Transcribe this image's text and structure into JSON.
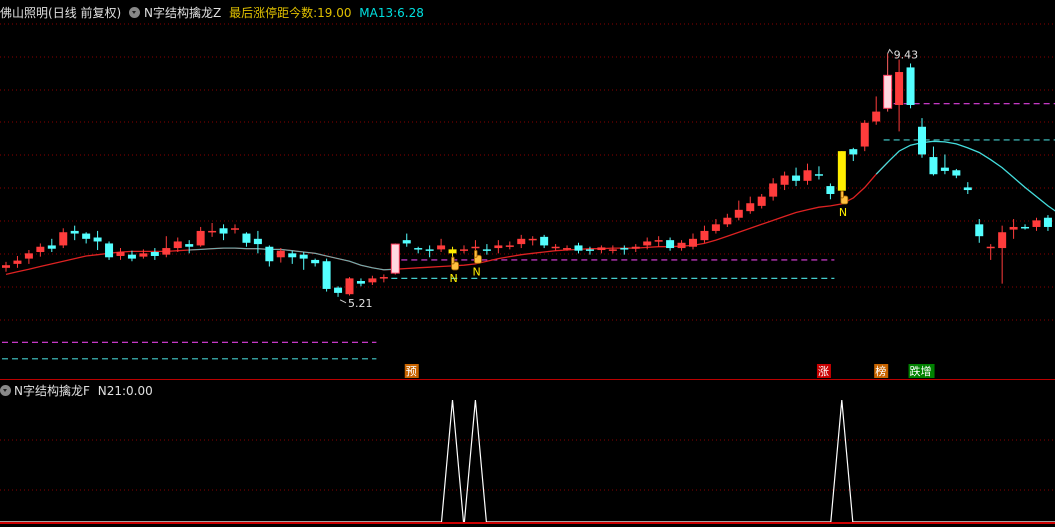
{
  "header": {
    "stock_name": "佛山照明",
    "period": "(日线 前复权)",
    "indicator_name": "N字结构擒龙Z",
    "last_limit_label": "最后涨停距今数:",
    "last_limit_value": "19.00",
    "ma_label": "MA13:",
    "ma_value": "6.28",
    "colors": {
      "stock": "#e0e0e0",
      "indicator": "#e0e0e0",
      "label": "#ffff00",
      "ma": "#00ffff"
    }
  },
  "sub_header": {
    "indicator_name": "N字结构擒龙F",
    "n21_label": "N21:",
    "n21_value": "0.00"
  },
  "annotations": {
    "high_label": "9.43",
    "low_label": "5.21",
    "n_marker": "N",
    "signals": [
      {
        "text": "预",
        "color": "#c86400"
      },
      {
        "text": "涨",
        "color": "#c80000"
      },
      {
        "text": "榜",
        "color": "#c86400"
      },
      {
        "text": "跌增",
        "color": "#008000"
      }
    ]
  },
  "chart_data": [
    {
      "type": "candlestick",
      "title": "佛山照明",
      "ylim": [
        4.6,
        10.0
      ],
      "up_color": "#ff3c3c",
      "down_color": "#54ffff",
      "ma_color": "#dd2222",
      "ma_color_after_peak": "#44dddd",
      "candles": [
        {
          "o": 6.18,
          "h": 6.27,
          "c": 6.22,
          "l": 6.12
        },
        {
          "o": 6.24,
          "h": 6.36,
          "c": 6.29,
          "l": 6.18
        },
        {
          "o": 6.32,
          "h": 6.45,
          "c": 6.4,
          "l": 6.24
        },
        {
          "o": 6.42,
          "h": 6.55,
          "c": 6.5,
          "l": 6.35
        },
        {
          "o": 6.52,
          "h": 6.62,
          "c": 6.47,
          "l": 6.42
        },
        {
          "o": 6.52,
          "h": 6.78,
          "c": 6.72,
          "l": 6.48
        },
        {
          "o": 6.74,
          "h": 6.82,
          "c": 6.7,
          "l": 6.6
        },
        {
          "o": 6.7,
          "h": 6.72,
          "c": 6.62,
          "l": 6.55
        },
        {
          "o": 6.64,
          "h": 6.74,
          "c": 6.58,
          "l": 6.45
        },
        {
          "o": 6.55,
          "h": 6.58,
          "c": 6.34,
          "l": 6.3
        },
        {
          "o": 6.36,
          "h": 6.48,
          "c": 6.42,
          "l": 6.3
        },
        {
          "o": 6.38,
          "h": 6.44,
          "c": 6.32,
          "l": 6.28
        },
        {
          "o": 6.35,
          "h": 6.46,
          "c": 6.4,
          "l": 6.32
        },
        {
          "o": 6.42,
          "h": 6.48,
          "c": 6.36,
          "l": 6.3
        },
        {
          "o": 6.38,
          "h": 6.66,
          "c": 6.48,
          "l": 6.34
        },
        {
          "o": 6.48,
          "h": 6.64,
          "c": 6.58,
          "l": 6.42
        },
        {
          "o": 6.54,
          "h": 6.6,
          "c": 6.5,
          "l": 6.4
        },
        {
          "o": 6.52,
          "h": 6.8,
          "c": 6.74,
          "l": 6.5
        },
        {
          "o": 6.72,
          "h": 6.86,
          "c": 6.74,
          "l": 6.65
        },
        {
          "o": 6.78,
          "h": 6.84,
          "c": 6.7,
          "l": 6.6
        },
        {
          "o": 6.76,
          "h": 6.84,
          "c": 6.78,
          "l": 6.7
        },
        {
          "o": 6.7,
          "h": 6.72,
          "c": 6.56,
          "l": 6.5
        },
        {
          "o": 6.62,
          "h": 6.74,
          "c": 6.54,
          "l": 6.4
        },
        {
          "o": 6.5,
          "h": 6.52,
          "c": 6.28,
          "l": 6.2
        },
        {
          "o": 6.34,
          "h": 6.48,
          "c": 6.44,
          "l": 6.26
        },
        {
          "o": 6.4,
          "h": 6.44,
          "c": 6.34,
          "l": 6.24
        },
        {
          "o": 6.38,
          "h": 6.42,
          "c": 6.32,
          "l": 6.15
        },
        {
          "o": 6.3,
          "h": 6.32,
          "c": 6.25,
          "l": 6.2
        },
        {
          "o": 6.28,
          "h": 6.32,
          "c": 5.86,
          "l": 5.82
        },
        {
          "o": 5.88,
          "h": 5.9,
          "c": 5.8,
          "l": 5.74
        },
        {
          "o": 5.78,
          "h": 6.04,
          "c": 6.02,
          "l": 5.76
        },
        {
          "o": 5.98,
          "h": 6.02,
          "c": 5.94,
          "l": 5.9
        },
        {
          "o": 5.96,
          "h": 6.06,
          "c": 6.02,
          "l": 5.92
        },
        {
          "o": 6.02,
          "h": 6.08,
          "c": 6.04,
          "l": 5.96
        },
        {
          "o": 6.1,
          "h": 6.55,
          "c": 6.54,
          "l": 6.08
        },
        {
          "o": 6.6,
          "h": 6.7,
          "c": 6.55,
          "l": 6.5
        },
        {
          "o": 6.48,
          "h": 6.5,
          "c": 6.46,
          "l": 6.4
        },
        {
          "o": 6.46,
          "h": 6.52,
          "c": 6.44,
          "l": 6.34
        },
        {
          "o": 6.46,
          "h": 6.62,
          "c": 6.52,
          "l": 6.42
        },
        {
          "o": 6.46,
          "h": 6.5,
          "c": 6.4,
          "l": 6.3
        },
        {
          "o": 6.46,
          "h": 6.52,
          "c": 6.46,
          "l": 6.4
        },
        {
          "o": 6.48,
          "h": 6.6,
          "c": 6.5,
          "l": 6.4
        },
        {
          "o": 6.46,
          "h": 6.54,
          "c": 6.44,
          "l": 6.38
        },
        {
          "o": 6.48,
          "h": 6.6,
          "c": 6.52,
          "l": 6.4
        },
        {
          "o": 6.5,
          "h": 6.58,
          "c": 6.52,
          "l": 6.46
        },
        {
          "o": 6.54,
          "h": 6.68,
          "c": 6.62,
          "l": 6.48
        },
        {
          "o": 6.6,
          "h": 6.66,
          "c": 6.62,
          "l": 6.52
        },
        {
          "o": 6.65,
          "h": 6.68,
          "c": 6.52,
          "l": 6.48
        },
        {
          "o": 6.5,
          "h": 6.54,
          "c": 6.5,
          "l": 6.44
        },
        {
          "o": 6.48,
          "h": 6.52,
          "c": 6.48,
          "l": 6.44
        },
        {
          "o": 6.52,
          "h": 6.56,
          "c": 6.44,
          "l": 6.4
        },
        {
          "o": 6.46,
          "h": 6.5,
          "c": 6.45,
          "l": 6.38
        },
        {
          "o": 6.45,
          "h": 6.52,
          "c": 6.49,
          "l": 6.4
        },
        {
          "o": 6.46,
          "h": 6.52,
          "c": 6.46,
          "l": 6.4
        },
        {
          "o": 6.48,
          "h": 6.52,
          "c": 6.46,
          "l": 6.38
        },
        {
          "o": 6.47,
          "h": 6.54,
          "c": 6.5,
          "l": 6.42
        },
        {
          "o": 6.52,
          "h": 6.64,
          "c": 6.58,
          "l": 6.46
        },
        {
          "o": 6.58,
          "h": 6.66,
          "c": 6.6,
          "l": 6.5
        },
        {
          "o": 6.6,
          "h": 6.64,
          "c": 6.48,
          "l": 6.44
        },
        {
          "o": 6.48,
          "h": 6.6,
          "c": 6.56,
          "l": 6.44
        },
        {
          "o": 6.5,
          "h": 6.7,
          "c": 6.62,
          "l": 6.46
        },
        {
          "o": 6.6,
          "h": 6.82,
          "c": 6.74,
          "l": 6.56
        },
        {
          "o": 6.74,
          "h": 6.92,
          "c": 6.84,
          "l": 6.7
        },
        {
          "o": 6.84,
          "h": 7.0,
          "c": 6.94,
          "l": 6.8
        },
        {
          "o": 6.94,
          "h": 7.2,
          "c": 7.06,
          "l": 6.9
        },
        {
          "o": 7.04,
          "h": 7.26,
          "c": 7.16,
          "l": 7.0
        },
        {
          "o": 7.12,
          "h": 7.3,
          "c": 7.26,
          "l": 7.08
        },
        {
          "o": 7.26,
          "h": 7.54,
          "c": 7.46,
          "l": 7.2
        },
        {
          "o": 7.44,
          "h": 7.64,
          "c": 7.58,
          "l": 7.36
        },
        {
          "o": 7.58,
          "h": 7.7,
          "c": 7.5,
          "l": 7.42
        },
        {
          "o": 7.5,
          "h": 7.76,
          "c": 7.66,
          "l": 7.44
        },
        {
          "o": 7.6,
          "h": 7.72,
          "c": 7.58,
          "l": 7.52
        },
        {
          "o": 7.42,
          "h": 7.46,
          "c": 7.3,
          "l": 7.22
        },
        {
          "o": 7.35,
          "h": 7.95,
          "c": 7.95,
          "l": 7.3
        },
        {
          "o": 7.98,
          "h": 8.0,
          "c": 7.9,
          "l": 7.8
        },
        {
          "o": 8.02,
          "h": 8.42,
          "c": 8.38,
          "l": 7.95
        },
        {
          "o": 8.4,
          "h": 8.78,
          "c": 8.55,
          "l": 8.35
        },
        {
          "o": 8.6,
          "h": 9.43,
          "c": 9.1,
          "l": 8.55
        },
        {
          "o": 8.65,
          "h": 9.34,
          "c": 9.15,
          "l": 8.25
        },
        {
          "o": 9.22,
          "h": 9.28,
          "c": 8.65,
          "l": 8.6
        },
        {
          "o": 8.32,
          "h": 8.45,
          "c": 7.9,
          "l": 7.85
        },
        {
          "o": 7.86,
          "h": 8.02,
          "c": 7.6,
          "l": 7.58
        },
        {
          "o": 7.7,
          "h": 7.9,
          "c": 7.65,
          "l": 7.6
        },
        {
          "o": 7.66,
          "h": 7.68,
          "c": 7.58,
          "l": 7.54
        },
        {
          "o": 7.4,
          "h": 7.48,
          "c": 7.36,
          "l": 7.3
        },
        {
          "o": 6.84,
          "h": 6.92,
          "c": 6.66,
          "l": 6.56
        },
        {
          "o": 6.48,
          "h": 6.54,
          "c": 6.5,
          "l": 6.3
        },
        {
          "o": 6.48,
          "h": 6.82,
          "c": 6.72,
          "l": 5.94
        },
        {
          "o": 6.76,
          "h": 6.92,
          "c": 6.8,
          "l": 6.62
        },
        {
          "o": 6.8,
          "h": 6.84,
          "c": 6.78,
          "l": 6.76
        },
        {
          "o": 6.8,
          "h": 6.94,
          "c": 6.9,
          "l": 6.74
        },
        {
          "o": 6.94,
          "h": 6.98,
          "c": 6.8,
          "l": 6.74
        },
        {
          "o": 6.8,
          "h": 6.84,
          "c": 6.62,
          "l": 6.56
        },
        {
          "o": 6.64,
          "h": 6.7,
          "c": 6.6,
          "l": 6.5
        },
        {
          "o": 6.6,
          "h": 6.84,
          "c": 6.8,
          "l": 6.56
        },
        {
          "o": 6.8,
          "h": 6.86,
          "c": 6.82,
          "l": 6.74
        }
      ],
      "special_candles": [
        {
          "index": 34,
          "kind": "hollow-pink"
        },
        {
          "index": 39,
          "kind": "yellow"
        },
        {
          "index": 73,
          "kind": "yellow"
        },
        {
          "index": 77,
          "kind": "hollow-pink"
        }
      ],
      "n_marker_indices": [
        39,
        41,
        73
      ],
      "peak_index": 77,
      "trough_index": 29,
      "ma13": [
        6.08,
        6.12,
        6.16,
        6.2,
        6.24,
        6.28,
        6.32,
        6.36,
        6.38,
        6.4,
        6.42,
        6.43,
        6.43,
        6.43,
        6.43,
        6.44,
        6.45,
        6.46,
        6.47,
        6.48,
        6.48,
        6.47,
        6.47,
        6.46,
        6.46,
        6.44,
        6.42,
        6.4,
        6.36,
        6.32,
        6.28,
        6.22,
        6.18,
        6.15,
        6.16,
        6.17,
        6.18,
        6.19,
        6.2,
        6.21,
        6.22,
        6.24,
        6.28,
        6.32,
        6.35,
        6.38,
        6.4,
        6.42,
        6.44,
        6.45,
        6.46,
        6.47,
        6.47,
        6.48,
        6.48,
        6.48,
        6.49,
        6.5,
        6.5,
        6.51,
        6.52,
        6.55,
        6.6,
        6.66,
        6.72,
        6.78,
        6.84,
        6.9,
        6.96,
        7.02,
        7.06,
        7.1,
        7.12,
        7.15,
        7.24,
        7.4,
        7.6,
        7.78,
        7.95,
        8.04,
        8.08,
        8.1,
        8.09,
        8.06,
        8.0,
        7.93,
        7.82,
        7.7,
        7.55,
        7.4,
        7.26,
        7.12,
        7.0,
        6.91,
        6.86,
        6.82,
        6.79,
        6.76,
        6.75
      ],
      "dashed_levels": [
        {
          "price": 8.67,
          "from": 77,
          "to": 99,
          "color": "#e040e0"
        },
        {
          "price": 8.12,
          "from": 77,
          "to": 99,
          "color": "#44cccc"
        },
        {
          "price": 6.3,
          "from": 34,
          "to": 72,
          "color": "#e040e0"
        },
        {
          "price": 6.02,
          "from": 34,
          "to": 72,
          "color": "#44cccc"
        },
        {
          "price": 5.05,
          "from": 0,
          "to": 32,
          "color": "#e040e0"
        },
        {
          "price": 4.8,
          "from": 0,
          "to": 32,
          "color": "#44cccc"
        }
      ]
    },
    {
      "type": "line",
      "title": "N字结构擒龙F",
      "series": [
        {
          "name": "N21",
          "spikes_at": [
            39,
            41,
            73
          ],
          "base": 0,
          "peak": 1
        }
      ]
    }
  ]
}
